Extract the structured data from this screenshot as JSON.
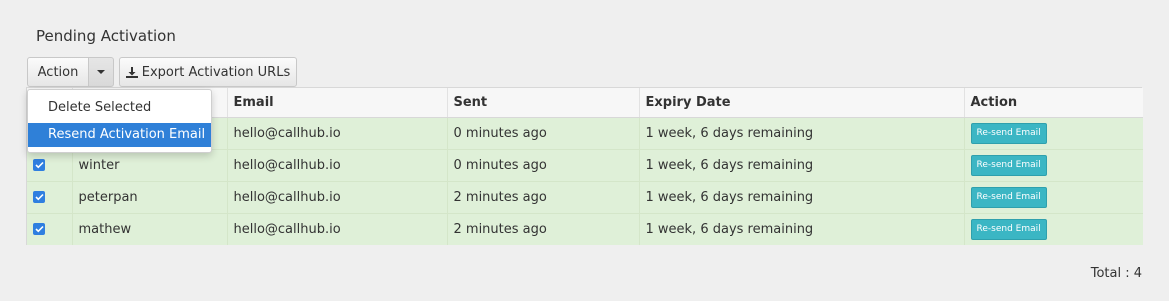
{
  "section": {
    "title": "Pending Activation"
  },
  "toolbar": {
    "action_label": "Action",
    "export_label": "Export Activation URLs"
  },
  "dropdown": {
    "items": [
      "Delete Selected",
      "Resend Activation Email"
    ],
    "active_index": 1
  },
  "table": {
    "columns": [
      "",
      "",
      "Email",
      "Sent",
      "Expiry Date",
      "Action"
    ],
    "rows": [
      {
        "checked": true,
        "name": "",
        "email": "hello@callhub.io",
        "sent": "0 minutes ago",
        "expiry": "1 week, 6 days remaining",
        "action": "Re-send Email"
      },
      {
        "checked": true,
        "name": "winter",
        "email": "hello@callhub.io",
        "sent": "0 minutes ago",
        "expiry": "1 week, 6 days remaining",
        "action": "Re-send Email"
      },
      {
        "checked": true,
        "name": "peterpan",
        "email": "hello@callhub.io",
        "sent": "2 minutes ago",
        "expiry": "1 week, 6 days remaining",
        "action": "Re-send Email"
      },
      {
        "checked": true,
        "name": "mathew",
        "email": "hello@callhub.io",
        "sent": "2 minutes ago",
        "expiry": "1 week, 6 days remaining",
        "action": "Re-send Email"
      }
    ]
  },
  "footer": {
    "total": "Total : 4"
  },
  "colors": {
    "row_bg": "#dff0d8",
    "accent": "#2f80d8",
    "resend_bg": "#3bb6c4"
  }
}
